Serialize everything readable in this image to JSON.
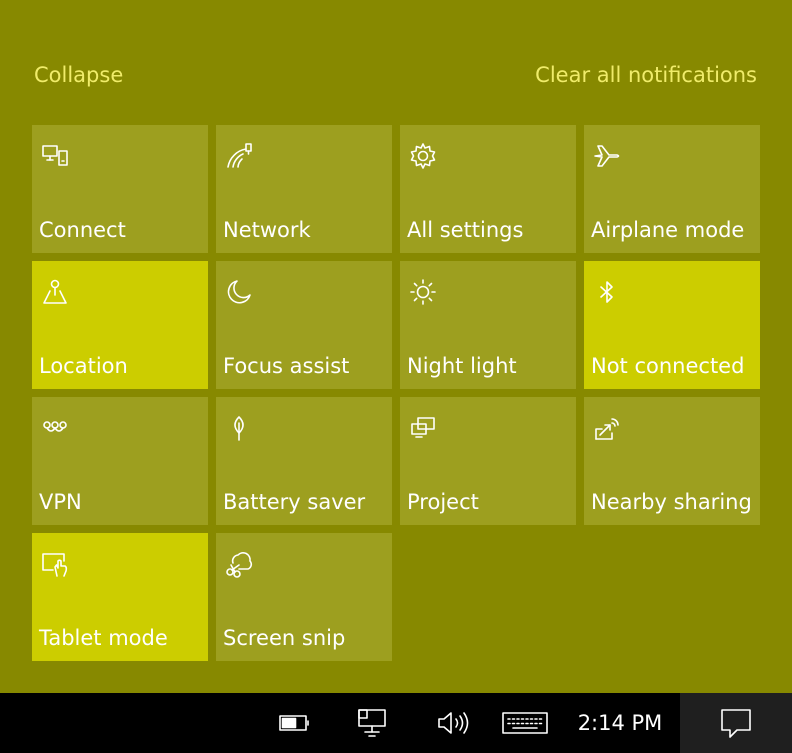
{
  "header": {
    "collapse_label": "Collapse",
    "clear_label": "Clear all notifications"
  },
  "tiles": [
    {
      "label": "Connect",
      "icon": "connect-icon",
      "active": false
    },
    {
      "label": "Network",
      "icon": "network-icon",
      "active": false
    },
    {
      "label": "All settings",
      "icon": "gear-icon",
      "active": false
    },
    {
      "label": "Airplane mode",
      "icon": "airplane-icon",
      "active": false
    },
    {
      "label": "Location",
      "icon": "location-icon",
      "active": true
    },
    {
      "label": "Focus assist",
      "icon": "moon-icon",
      "active": false
    },
    {
      "label": "Night light",
      "icon": "sun-icon",
      "active": false
    },
    {
      "label": "Not connected",
      "icon": "bluetooth-icon",
      "active": true
    },
    {
      "label": "VPN",
      "icon": "vpn-icon",
      "active": false
    },
    {
      "label": "Battery saver",
      "icon": "battery-saver-icon",
      "active": false
    },
    {
      "label": "Project",
      "icon": "project-icon",
      "active": false
    },
    {
      "label": "Nearby sharing",
      "icon": "nearby-sharing-icon",
      "active": false
    },
    {
      "label": "Tablet mode",
      "icon": "tablet-mode-icon",
      "active": true
    },
    {
      "label": "Screen snip",
      "icon": "screen-snip-icon",
      "active": false
    }
  ],
  "taskbar": {
    "time": "2:14 PM",
    "icons": [
      "battery-icon",
      "network-icon",
      "volume-icon",
      "keyboard-icon",
      "notification-icon"
    ]
  },
  "colors": {
    "panel_background": "#878900",
    "tile_inactive": "#9d9f1f",
    "tile_active": "#cccd00",
    "link_text": "#f0ec6a",
    "taskbar_background": "#000000"
  }
}
